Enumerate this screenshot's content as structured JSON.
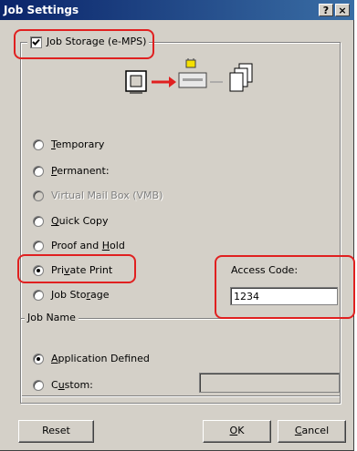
{
  "window": {
    "title": "Job Settings",
    "help_label": "?",
    "close_label": "×"
  },
  "job_storage": {
    "enable_label_pre": "",
    "enable_label_ul": "J",
    "enable_label_post": "ob Storage (e-MPS)",
    "checked": true
  },
  "options": [
    {
      "pre": "",
      "ul": "T",
      "post": "emporary",
      "checked": false,
      "disabled": false
    },
    {
      "pre": "",
      "ul": "P",
      "post": "ermanent:",
      "checked": false,
      "disabled": false
    },
    {
      "pre": "Virtual Mail Box (VMB)",
      "ul": "",
      "post": "",
      "checked": false,
      "disabled": true
    },
    {
      "pre": "",
      "ul": "Q",
      "post": "uick Copy",
      "checked": false,
      "disabled": false
    },
    {
      "pre": "Proof and ",
      "ul": "H",
      "post": "old",
      "checked": false,
      "disabled": false
    },
    {
      "pre": "Pri",
      "ul": "v",
      "post": "ate Print",
      "checked": true,
      "disabled": false
    },
    {
      "pre": "Job Sto",
      "ul": "r",
      "post": "age",
      "checked": false,
      "disabled": false
    }
  ],
  "access_code": {
    "label": "Access Code:",
    "value": "1234"
  },
  "job_name": {
    "legend": "Job Name",
    "application_defined": {
      "pre": "",
      "ul": "A",
      "post": "pplication Defined",
      "checked": true
    },
    "custom": {
      "pre": "C",
      "ul": "u",
      "post": "stom:",
      "checked": false,
      "value": ""
    }
  },
  "buttons": {
    "reset": "Reset",
    "ok_ul": "O",
    "ok_post": "K",
    "cancel_ul": "C",
    "cancel_post": "ancel"
  },
  "colors": {
    "highlight": "#e02020",
    "arrow": "#e02020",
    "title_bar": "#0a246a"
  }
}
